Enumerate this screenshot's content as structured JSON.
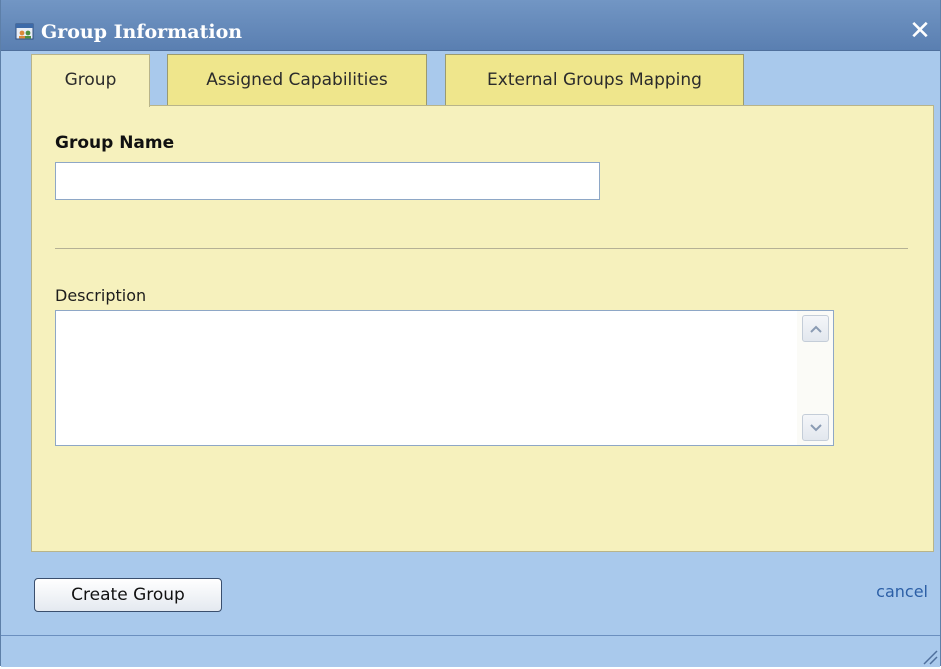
{
  "window": {
    "title": "Group Information",
    "close_label": "✕",
    "icon": "group-window-icon"
  },
  "tabs": [
    {
      "label": "Group",
      "active": true
    },
    {
      "label": "Assigned Capabilities",
      "active": false
    },
    {
      "label": "External Groups Mapping",
      "active": false
    }
  ],
  "form": {
    "group_name_label": "Group Name",
    "group_name_value": "",
    "description_label": "Description",
    "description_value": ""
  },
  "footer": {
    "create_button_label": "Create Group",
    "cancel_link_label": "cancel"
  },
  "colors": {
    "title_bar": "#5a7fb1",
    "dialog_background": "#a9c9ec",
    "panel_background": "#f6f1bd",
    "inactive_tab": "#efe68c",
    "link": "#2c5fa6"
  }
}
